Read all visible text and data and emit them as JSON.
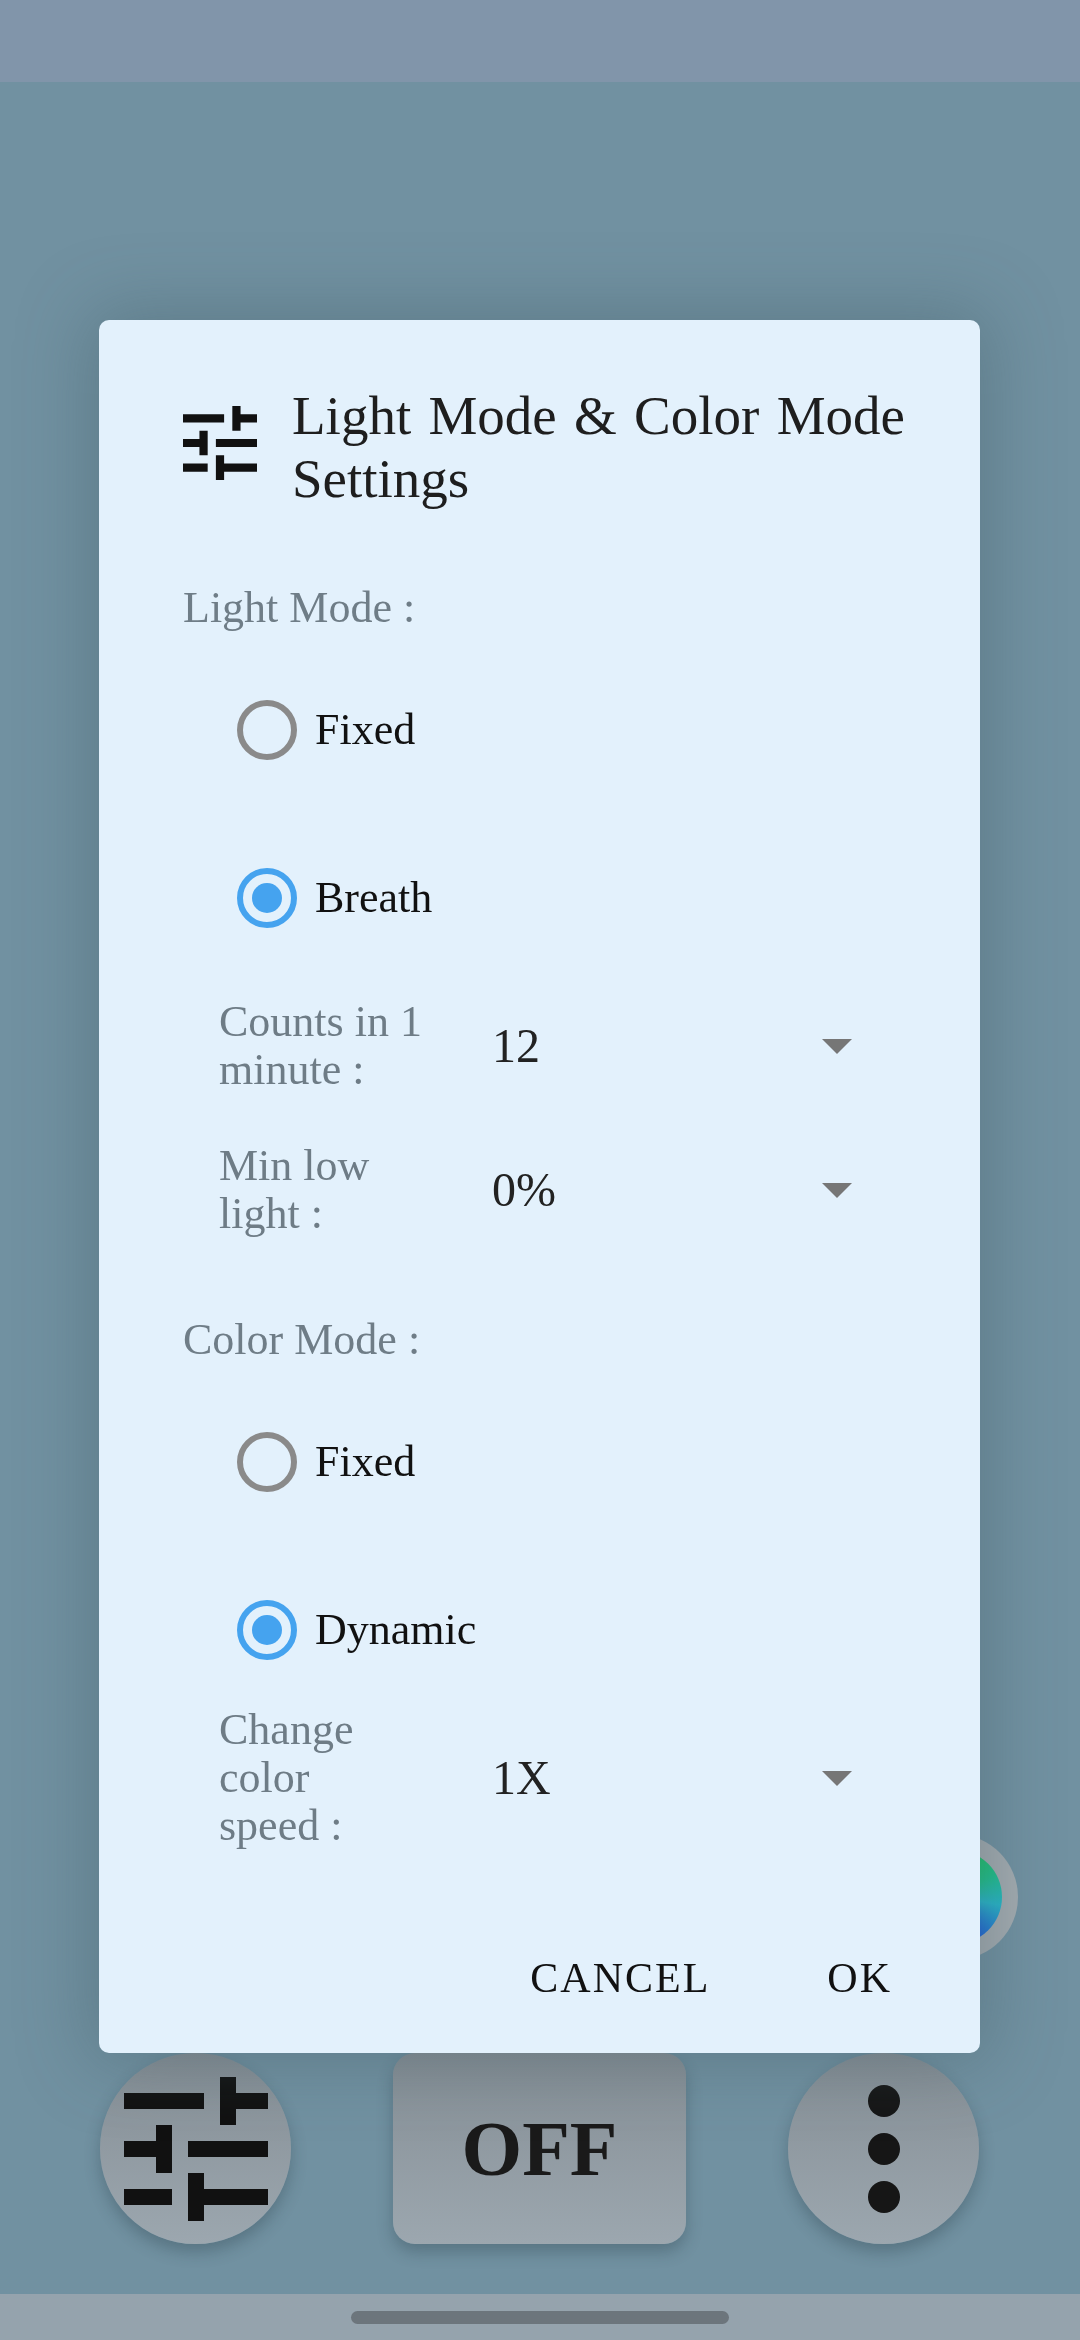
{
  "dialog": {
    "title": "Light Mode & Color Mode Settings",
    "sections": [
      {
        "label": "Light Mode :",
        "options": [
          {
            "label": "Fixed",
            "selected": false
          },
          {
            "label": "Breath",
            "selected": true
          }
        ],
        "fields": [
          {
            "label": "Counts in 1 minute :",
            "value": "12"
          },
          {
            "label": "Min low light :",
            "value": "0%"
          }
        ]
      },
      {
        "label": "Color Mode :",
        "options": [
          {
            "label": "Fixed",
            "selected": false
          },
          {
            "label": "Dynamic",
            "selected": true
          }
        ],
        "fields": [
          {
            "label": "Change color speed :",
            "value": "1X"
          }
        ]
      }
    ],
    "buttons": [
      "CANCEL",
      "OK"
    ]
  },
  "bottom_bar": {
    "toggle_label": "OFF"
  }
}
